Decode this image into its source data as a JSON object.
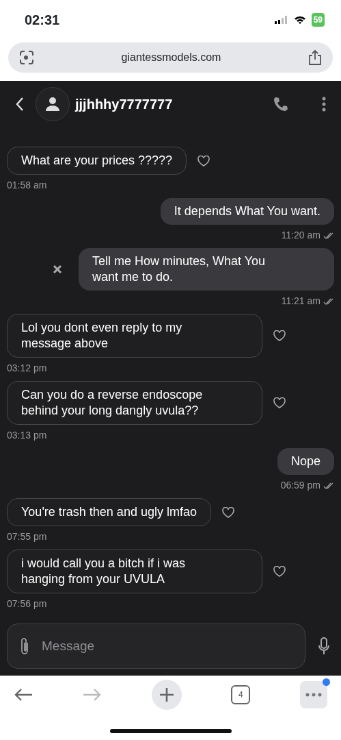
{
  "status_bar": {
    "time": "02:31",
    "battery": "59"
  },
  "address_bar": {
    "url": "giantessmodels.com"
  },
  "chat": {
    "contact": "jjjhhhy7777777",
    "messages": [
      {
        "kind": "in",
        "text": "What are your prices ?????",
        "time": "01:58 am",
        "liked": false
      },
      {
        "kind": "out",
        "text": "It depends What You want.",
        "time": "11:20 am",
        "read": true,
        "dismissable": false
      },
      {
        "kind": "out",
        "text": "Tell me How minutes, What You\nwant me to do.",
        "time": "11:21 am",
        "read": true,
        "dismissable": true
      },
      {
        "kind": "in",
        "text": "Lol you dont even reply to my\nmessage above",
        "time": "03:12 pm",
        "liked": false
      },
      {
        "kind": "in",
        "text": "Can you do a reverse endoscope\nbehind your long dangly uvula??",
        "time": "03:13 pm",
        "liked": false
      },
      {
        "kind": "out",
        "text": "Nope",
        "time": "06:59 pm",
        "read": true,
        "dismissable": false
      },
      {
        "kind": "in",
        "text": "You're trash then and ugly lmfao",
        "time": "07:55 pm",
        "liked": false
      },
      {
        "kind": "in",
        "text": "i would call you a bitch if i was\nhanging from your UVULA",
        "time": "07:56 pm",
        "liked": false
      }
    ],
    "composer": {
      "placeholder": "Message"
    }
  },
  "toolbar": {
    "tab_count": "4",
    "forward_disabled": true,
    "menu_badge": true
  }
}
